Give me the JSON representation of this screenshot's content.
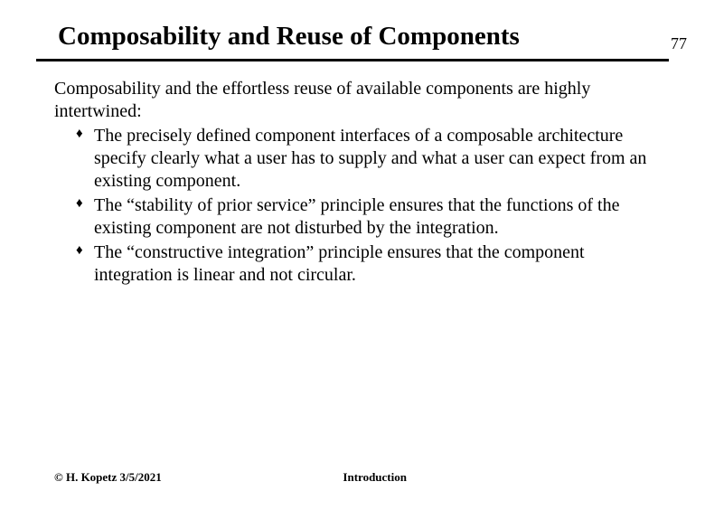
{
  "page_number": "77",
  "title": "Composability and Reuse of Components",
  "intro": "Composability and the effortless reuse of available components are highly intertwined:",
  "bullets": [
    "The precisely defined component interfaces of a composable architecture specify clearly what a user has to supply and what a user can expect from an existing component.",
    "The “stability of prior service” principle ensures that the functions of the existing component are not disturbed by the integration.",
    "The “constructive integration” principle ensures that the component integration is linear and not circular."
  ],
  "footer": {
    "copyright": "© H. Kopetz 3/5/2021",
    "section": "Introduction"
  }
}
